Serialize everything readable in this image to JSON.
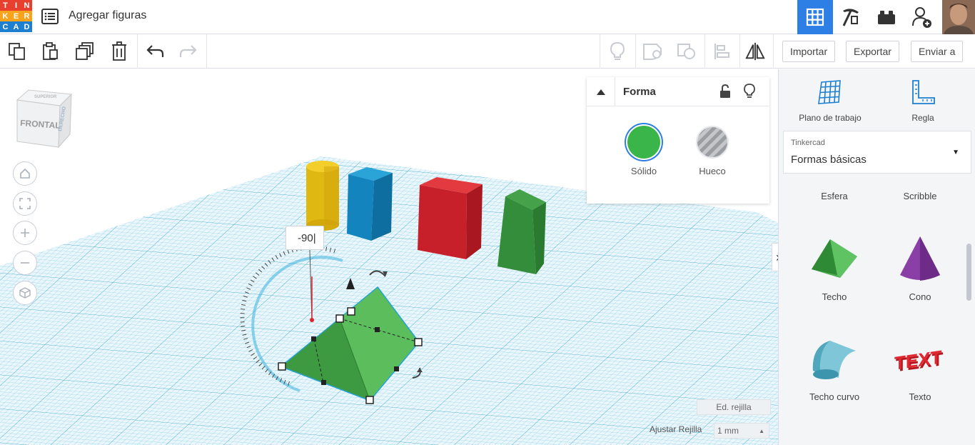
{
  "app": {
    "logo_letters": [
      "T",
      "I",
      "N",
      "K",
      "E",
      "R",
      "C",
      "A",
      "D"
    ],
    "logo_colors": [
      "#e8402f",
      "#e8402f",
      "#e8402f",
      "#f7a31c",
      "#f7a31c",
      "#f7a31c",
      "#1d7fd0",
      "#1d7fd0",
      "#1d7fd0"
    ],
    "title": "Agregar figuras",
    "menu_icon": "list-icon"
  },
  "views": [
    {
      "name": "3d-design",
      "icon": "grid-icon",
      "active": true
    },
    {
      "name": "blocks",
      "icon": "pickaxe-icon",
      "active": false
    },
    {
      "name": "bricks",
      "icon": "brick-icon",
      "active": false
    },
    {
      "name": "invite",
      "icon": "add-user-icon",
      "active": false
    }
  ],
  "toolbar": {
    "left_tools": [
      "copy-icon",
      "paste-icon",
      "duplicate-icon",
      "delete-icon",
      "undo-icon",
      "redo-icon"
    ],
    "right_tools": [
      "bulb-icon",
      "group-icon",
      "ungroup-icon",
      "align-icon",
      "mirror-icon"
    ],
    "import_label": "Importar",
    "export_label": "Exportar",
    "send_label": "Enviar a"
  },
  "viewcube": {
    "front_label": "FRONTAL",
    "side_label": "DERECHO",
    "top_label": "SUPERIOR"
  },
  "workplane": {
    "rotation_value": "-90",
    "edit_grid_label": "Ed. rejilla",
    "snap_label": "Ajustar Rejilla",
    "snap_value": "1 mm",
    "grid_color": "#4fb8d8"
  },
  "inspector": {
    "title": "Forma",
    "solid_label": "Sólido",
    "hole_label": "Hueco",
    "solid_color": "#3ab54a"
  },
  "rightpanel": {
    "workplane_label": "Plano de trabajo",
    "ruler_label": "Regla",
    "library_provider": "Tinkercad",
    "library_name": "Formas básicas",
    "shapes": [
      {
        "label": "Esfera"
      },
      {
        "label": "Scribble"
      },
      {
        "label": "Techo"
      },
      {
        "label": "Cono"
      },
      {
        "label": "Techo curvo"
      },
      {
        "label": "Texto"
      }
    ]
  }
}
